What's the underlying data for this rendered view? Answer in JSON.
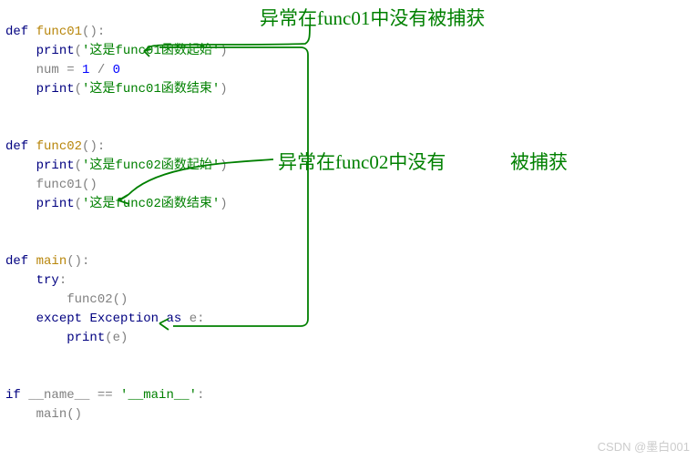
{
  "code": {
    "line1_def": "def",
    "line1_fn": "func01",
    "line1_rest": "():",
    "line2_print": "print",
    "line2_str": "'这是func01函数起始'",
    "line3_num": "num",
    "line3_eq": " = ",
    "line3_1": "1",
    "line3_div": " / ",
    "line3_0": "0",
    "line4_print": "print",
    "line4_str": "'这是func01函数结束'",
    "line6_def": "def",
    "line6_fn": "func02",
    "line6_rest": "():",
    "line7_print": "print",
    "line7_str": "'这是func02函数起始'",
    "line8_call": "func01",
    "line8_paren": "()",
    "line9_print": "print",
    "line9_str": "'这是func02函数结束'",
    "line11_def": "def",
    "line11_fn": "main",
    "line11_rest": "():",
    "line12_try": "try",
    "line12_colon": ":",
    "line13_call": "func02",
    "line13_paren": "()",
    "line14_except": "except",
    "line14_exc": "Exception",
    "line14_as": "as",
    "line14_e": "e:",
    "line15_print": "print",
    "line15_e": "e",
    "line17_if": "if",
    "line17_name": "__name__",
    "line17_eq": " == ",
    "line17_str": "'__main__'",
    "line17_colon": ":",
    "line18_call": "main",
    "line18_paren": "()"
  },
  "annotations": {
    "a1": "异常在func01中没有被捕获",
    "a2_left": "异常在func02中没有",
    "a2_right": "被捕获"
  },
  "watermark": "CSDN @墨白001"
}
